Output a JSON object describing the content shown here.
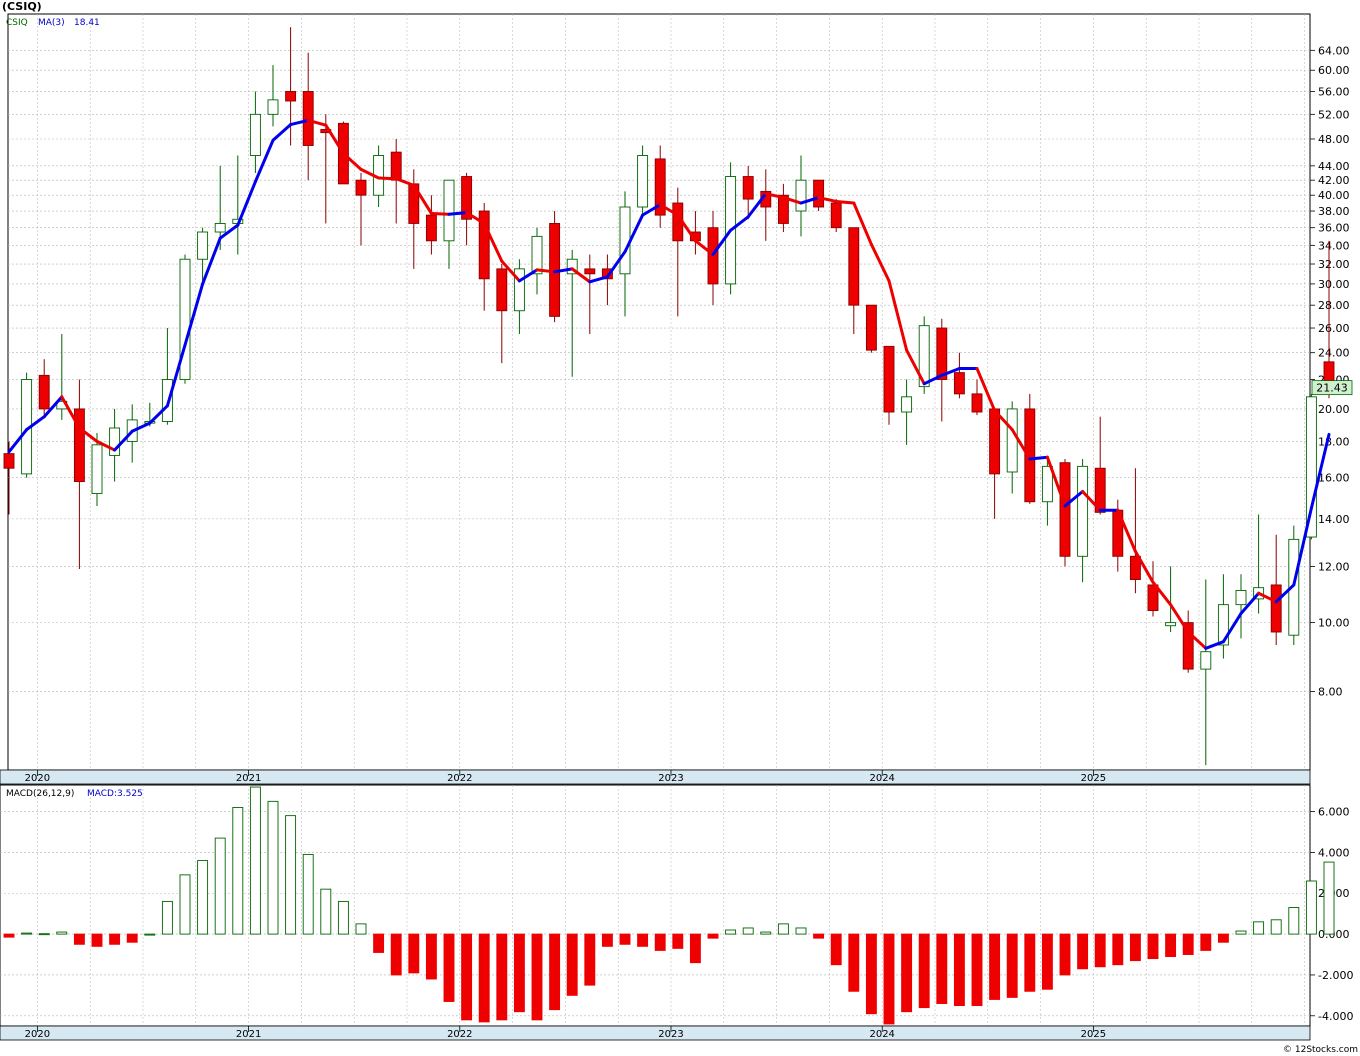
{
  "title": "(CSIQ)",
  "watermark": "© 12Stocks.com",
  "price_panel": {
    "ticker_label": "CSIQ",
    "ma_label": "MA(3)",
    "ma_value": "18.41",
    "last_price": "21.43",
    "y_ticks": [
      "8.00",
      "10.00",
      "12.00",
      "14.00",
      "16.00",
      "18.00",
      "20.00",
      "22.00",
      "24.00",
      "26.00",
      "28.00",
      "30.00",
      "32.00",
      "34.00",
      "36.00",
      "38.00",
      "40.00",
      "42.00",
      "44.00",
      "48.00",
      "52.00",
      "56.00",
      "60.00",
      "64.00"
    ],
    "x_ticks": [
      "2020",
      "2021",
      "2022",
      "2023",
      "2024",
      "2025"
    ]
  },
  "macd_panel": {
    "label": "MACD(26,12,9)",
    "value_label": "MACD:3.525",
    "y_ticks": [
      "-4.000",
      "-2.000",
      "0.000",
      "2.000",
      "4.000",
      "6.000"
    ],
    "x_ticks": [
      "2020",
      "2021",
      "2022",
      "2023",
      "2024",
      "2025"
    ]
  },
  "colors": {
    "up_fill": "#ffffff",
    "up_stroke": "#006400",
    "down_fill": "#ee0000",
    "down_stroke": "#880000",
    "ma_up": "#0000ee",
    "ma_down": "#ee0000",
    "grid": "#b4b4b4",
    "axis_band": "#d6e8f2",
    "last_price_box": "#d0f0d0"
  },
  "chart_data": [
    {
      "type": "candlestick",
      "title": "(CSIQ)",
      "scale": "log",
      "ylim": [
        6.2,
        72
      ],
      "x_years": [
        "2020",
        "2021",
        "2022",
        "2023",
        "2024",
        "2025"
      ],
      "ohlc": [
        [
          17.3,
          18.0,
          14.2,
          16.5
        ],
        [
          16.2,
          22.5,
          16.0,
          22.0
        ],
        [
          22.3,
          23.5,
          19.6,
          20.0
        ],
        [
          20.0,
          25.5,
          19.3,
          20.5
        ],
        [
          20.0,
          22.0,
          11.9,
          15.8
        ],
        [
          15.2,
          18.5,
          14.6,
          17.8
        ],
        [
          17.2,
          20.0,
          15.8,
          18.8
        ],
        [
          18.0,
          20.3,
          16.8,
          19.3
        ],
        [
          19.1,
          20.4,
          18.9,
          19.2
        ],
        [
          19.2,
          26.0,
          19.0,
          22.0
        ],
        [
          22.0,
          33.0,
          21.7,
          32.5
        ],
        [
          32.5,
          36.0,
          30.0,
          35.5
        ],
        [
          35.5,
          44.0,
          33.5,
          36.5
        ],
        [
          36.5,
          45.5,
          33.0,
          37.0
        ],
        [
          45.5,
          56.0,
          43.0,
          52.0
        ],
        [
          52.0,
          61.0,
          50.0,
          54.5
        ],
        [
          56.0,
          69.0,
          47.0,
          54.3
        ],
        [
          56.0,
          63.5,
          42.0,
          47.0
        ],
        [
          49.5,
          52.0,
          36.5,
          49.0
        ],
        [
          50.5,
          50.8,
          41.5,
          41.5
        ],
        [
          42.0,
          43.0,
          34.0,
          40.0
        ],
        [
          40.0,
          47.0,
          38.5,
          45.5
        ],
        [
          46.0,
          48.0,
          36.5,
          42.0
        ],
        [
          41.5,
          43.5,
          31.5,
          36.5
        ],
        [
          37.5,
          40.0,
          33.0,
          34.5
        ],
        [
          34.5,
          42.0,
          31.5,
          42.0
        ],
        [
          42.5,
          43.0,
          34.0,
          37.0
        ],
        [
          38.0,
          39.0,
          27.5,
          30.5
        ],
        [
          31.5,
          32.0,
          23.2,
          27.5
        ],
        [
          27.5,
          32.5,
          25.5,
          31.5
        ],
        [
          31.0,
          36.0,
          29.0,
          35.0
        ],
        [
          36.5,
          38.0,
          26.5,
          27.0
        ],
        [
          31.0,
          33.5,
          22.2,
          32.5
        ],
        [
          31.5,
          33.0,
          25.5,
          31.0
        ],
        [
          31.5,
          33.0,
          28.0,
          30.5
        ],
        [
          31.0,
          40.5,
          27.0,
          38.5
        ],
        [
          38.5,
          47.0,
          37.5,
          45.5
        ],
        [
          45.0,
          47.0,
          36.0,
          37.5
        ],
        [
          39.0,
          41.0,
          27.0,
          34.5
        ],
        [
          35.5,
          38.0,
          33.0,
          34.5
        ],
        [
          36.0,
          38.0,
          28.0,
          30.0
        ],
        [
          30.0,
          44.5,
          29.0,
          42.5
        ],
        [
          42.5,
          44.0,
          37.0,
          39.5
        ],
        [
          40.5,
          43.5,
          34.5,
          38.5
        ],
        [
          40.0,
          41.5,
          35.5,
          36.5
        ],
        [
          38.0,
          45.5,
          35.0,
          42.0
        ],
        [
          42.0,
          42.0,
          38.0,
          38.5
        ],
        [
          39.0,
          39.5,
          35.5,
          36.0
        ],
        [
          36.0,
          36.0,
          25.5,
          28.0
        ],
        [
          28.0,
          28.0,
          24.0,
          24.2
        ],
        [
          24.5,
          24.5,
          19.0,
          19.8
        ],
        [
          19.8,
          22.0,
          17.8,
          20.8
        ],
        [
          21.5,
          27.0,
          21.0,
          26.2
        ],
        [
          26.0,
          26.8,
          19.2,
          22.0
        ],
        [
          22.5,
          24.0,
          20.7,
          21.0
        ],
        [
          21.0,
          22.0,
          19.6,
          19.8
        ],
        [
          20.0,
          20.0,
          14.0,
          16.2
        ],
        [
          16.3,
          20.5,
          15.2,
          20.0
        ],
        [
          20.0,
          21.0,
          14.7,
          14.8
        ],
        [
          14.8,
          17.0,
          13.7,
          16.6
        ],
        [
          16.8,
          17.0,
          12.0,
          12.4
        ],
        [
          12.4,
          17.0,
          11.4,
          16.6
        ],
        [
          16.5,
          19.5,
          14.2,
          14.3
        ],
        [
          14.4,
          14.9,
          11.8,
          12.4
        ],
        [
          12.4,
          16.5,
          11.0,
          11.5
        ],
        [
          11.3,
          12.2,
          10.2,
          10.4
        ],
        [
          9.9,
          12.0,
          9.7,
          10.0
        ],
        [
          10.0,
          10.4,
          8.5,
          8.6
        ],
        [
          8.6,
          11.5,
          6.3,
          9.1
        ],
        [
          9.3,
          11.7,
          8.9,
          10.6
        ],
        [
          10.6,
          11.7,
          9.5,
          11.1
        ],
        [
          10.8,
          14.2,
          10.3,
          11.2
        ],
        [
          11.3,
          13.3,
          9.3,
          9.7
        ],
        [
          9.6,
          13.7,
          9.3,
          13.1
        ],
        [
          13.2,
          21.0,
          13.1,
          20.8
        ],
        [
          23.3,
          34.5,
          20.7,
          21.43
        ]
      ],
      "ma3": [
        17.4,
        18.7,
        19.5,
        20.8,
        18.8,
        18.0,
        17.5,
        18.6,
        19.1,
        20.2,
        24.6,
        30.0,
        34.8,
        36.3,
        41.8,
        47.8,
        50.3,
        51.0,
        50.2,
        45.8,
        43.5,
        42.3,
        42.2,
        41.3,
        37.7,
        37.6,
        37.8,
        36.5,
        32.3,
        30.3,
        31.4,
        31.2,
        31.5,
        30.2,
        30.7,
        33.3,
        37.5,
        38.8,
        37.5,
        34.5,
        33.0,
        35.7,
        37.3,
        40.2,
        39.7,
        39.0,
        39.7,
        39.2,
        39.0,
        34.1,
        30.3,
        24.2,
        21.7,
        22.3,
        22.8,
        22.8,
        19.9,
        18.7,
        17.0,
        17.1,
        14.6,
        15.3,
        14.4,
        14.4,
        12.6,
        11.4,
        10.6,
        9.7,
        9.2,
        9.4,
        10.3,
        11.0,
        10.7,
        11.3,
        14.5,
        18.41
      ],
      "last": 21.43
    },
    {
      "type": "bar",
      "title": "MACD(26,12,9)",
      "ylim": [
        -4.5,
        7.3
      ],
      "x_years": [
        "2020",
        "2021",
        "2022",
        "2023",
        "2024",
        "2025"
      ],
      "values": [
        -0.15,
        0.05,
        0.02,
        0.1,
        -0.5,
        -0.6,
        -0.5,
        -0.4,
        0.0,
        1.6,
        2.9,
        3.6,
        4.7,
        6.2,
        7.2,
        6.5,
        5.8,
        3.9,
        2.2,
        1.6,
        0.5,
        -0.9,
        -2.0,
        -1.9,
        -2.2,
        -3.3,
        -4.2,
        -4.3,
        -4.2,
        -3.8,
        -4.2,
        -3.7,
        -3.0,
        -2.5,
        -0.6,
        -0.5,
        -0.6,
        -0.8,
        -0.7,
        -1.4,
        -0.2,
        0.2,
        0.3,
        0.1,
        0.5,
        0.3,
        -0.2,
        -1.5,
        -2.8,
        -3.9,
        -4.4,
        -3.8,
        -3.6,
        -3.4,
        -3.5,
        -3.5,
        -3.2,
        -3.1,
        -2.8,
        -2.7,
        -2.0,
        -1.7,
        -1.6,
        -1.5,
        -1.3,
        -1.2,
        -1.1,
        -1.0,
        -0.8,
        -0.4,
        0.15,
        0.6,
        0.7,
        1.3,
        2.6,
        3.525
      ]
    }
  ]
}
